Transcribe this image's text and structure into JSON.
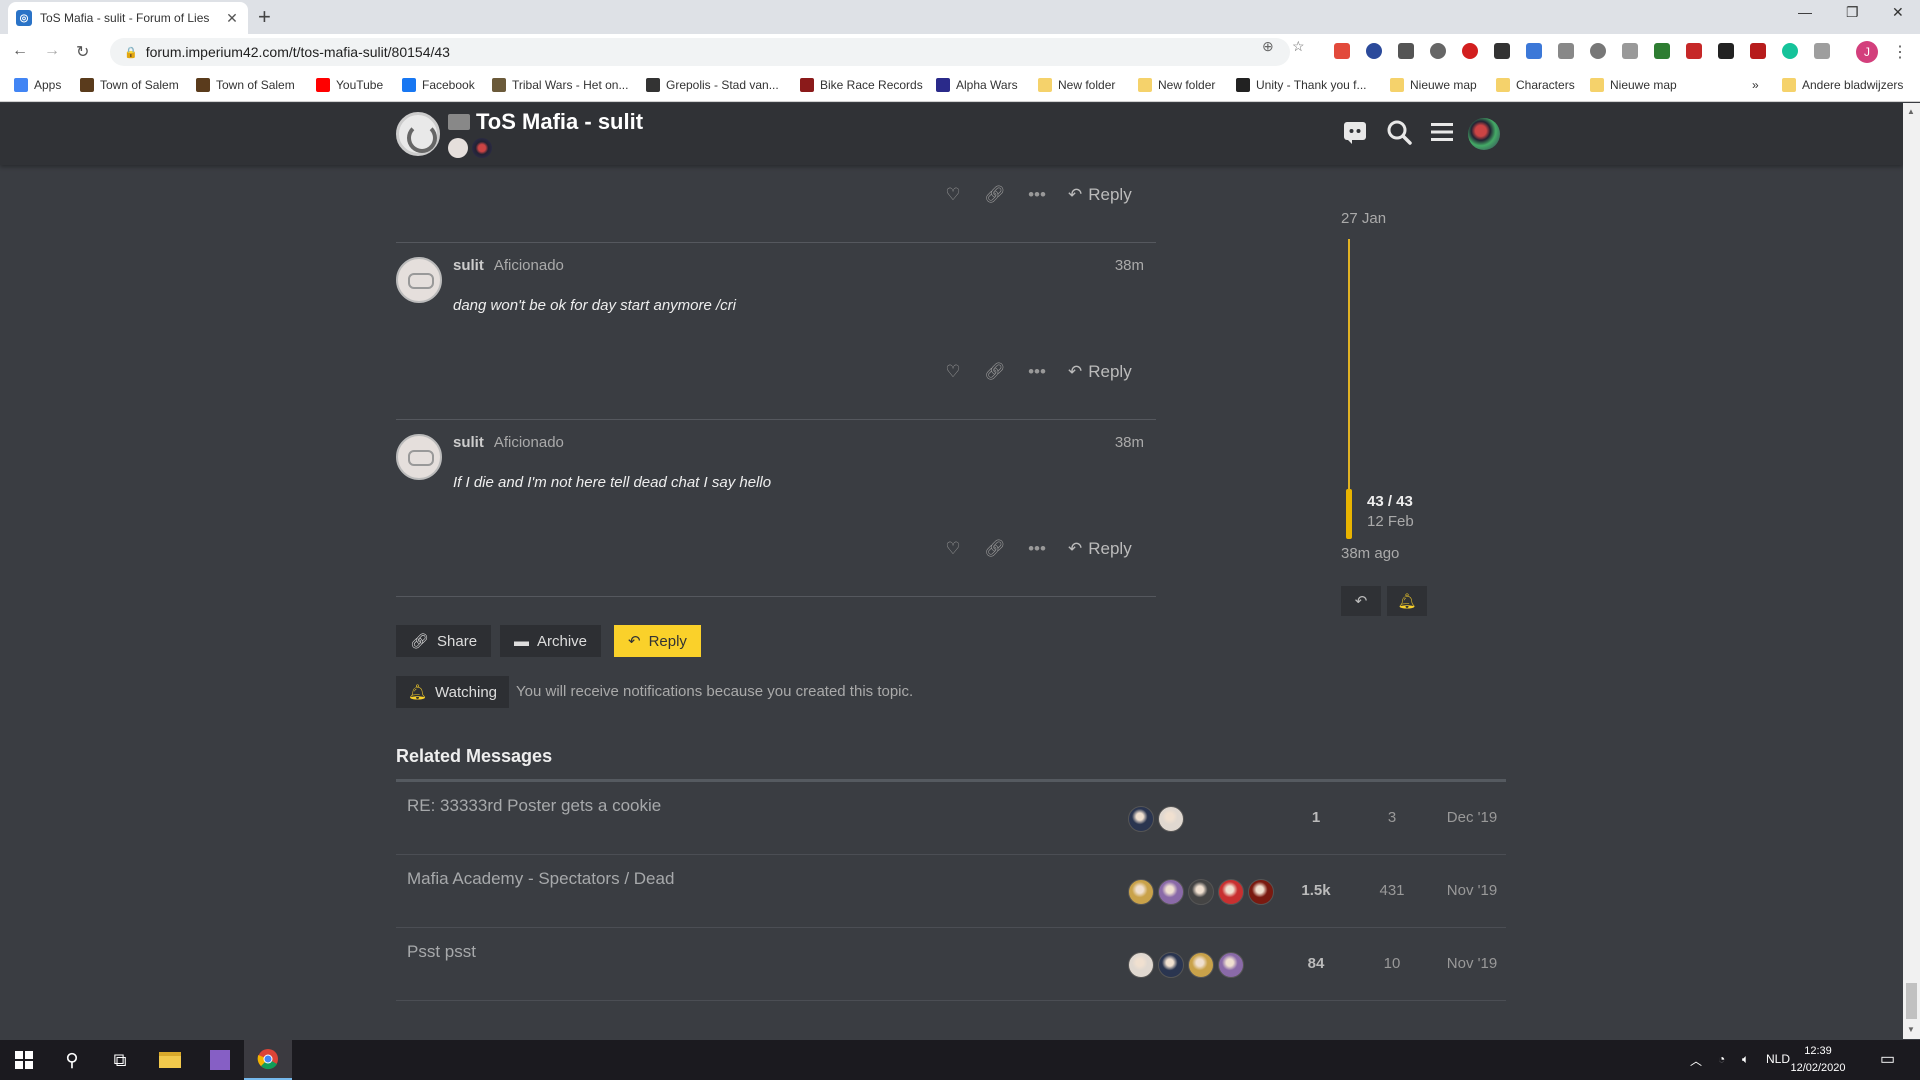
{
  "browser": {
    "tab_title": "ToS Mafia - sulit - Forum of Lies",
    "tab_icon": "forum-logo-icon",
    "url": "forum.imperium42.com/t/tos-mafia-sulit/80154/43",
    "profile_initial": "J",
    "bookmarks": [
      {
        "label": "Apps",
        "icon": "apps-grid-icon",
        "color": "#4285f4"
      },
      {
        "label": "Town of Salem",
        "icon": "tos-icon",
        "color": "#5a3b1c"
      },
      {
        "label": "Town of Salem",
        "icon": "tos-icon",
        "color": "#5a3b1c"
      },
      {
        "label": "YouTube",
        "icon": "youtube-icon",
        "color": "#ff0000"
      },
      {
        "label": "Facebook",
        "icon": "facebook-icon",
        "color": "#1877f2"
      },
      {
        "label": "Tribal Wars - Het on...",
        "icon": "tribal-wars-icon",
        "color": "#6b5a3a"
      },
      {
        "label": "Grepolis - Stad van...",
        "icon": "grepolis-icon",
        "color": "#333333"
      },
      {
        "label": "Bike Race Records",
        "icon": "bike-race-icon",
        "color": "#8b1a1a"
      },
      {
        "label": "Alpha Wars",
        "icon": "alpha-wars-icon",
        "color": "#2a2a8a"
      },
      {
        "label": "New folder",
        "icon": "folder-icon",
        "color": "#f5d26b"
      },
      {
        "label": "New folder",
        "icon": "folder-icon",
        "color": "#f5d26b"
      },
      {
        "label": "Unity - Thank you f...",
        "icon": "unity-icon",
        "color": "#222222"
      },
      {
        "label": "Nieuwe map",
        "icon": "folder-icon",
        "color": "#f5d26b"
      },
      {
        "label": "Characters",
        "icon": "folder-icon",
        "color": "#f5d26b"
      },
      {
        "label": "Nieuwe map",
        "icon": "folder-icon",
        "color": "#f5d26b"
      }
    ],
    "overflow": "»",
    "other_bookmarks": "Andere bladwijzers"
  },
  "header": {
    "title": "ToS Mafia - sulit"
  },
  "posts": [
    {
      "username": "sulit",
      "user_title": "Aficionado",
      "time": "38m",
      "body": "dang won't be ok for day start anymore /cri",
      "reply_label": "Reply"
    },
    {
      "username": "sulit",
      "user_title": "Aficionado",
      "time": "38m",
      "body": "If I die and I'm not here tell dead chat I say hello",
      "reply_label": "Reply"
    }
  ],
  "top_reply_label": "Reply",
  "timeline": {
    "start_date": "27 Jan",
    "position": "43 / 43",
    "position_date": "12 Feb",
    "last_activity": "38m ago"
  },
  "footer_buttons": {
    "share": "Share",
    "archive": "Archive",
    "reply": "Reply",
    "watching": "Watching",
    "notice": "You will receive notifications because you created this topic."
  },
  "related": {
    "title": "Related Messages",
    "rows": [
      {
        "title": "RE: 33333rd Poster gets a cookie",
        "replies": "1",
        "views": "3",
        "date": "Dec '19",
        "avatars": [
          "#2a3550",
          "#e0d8d0"
        ]
      },
      {
        "title": "Mafia Academy - Spectators / Dead",
        "replies": "1.5k",
        "views": "431",
        "date": "Nov '19",
        "avatars": [
          "#c9a24a",
          "#8a6aa8",
          "#444444",
          "#c83030",
          "#7a1a10"
        ]
      },
      {
        "title": "Psst psst",
        "replies": "84",
        "views": "10",
        "date": "Nov '19",
        "avatars": [
          "#e0d8d0",
          "#2a3550",
          "#c9a24a",
          "#8a6aa8"
        ]
      }
    ]
  },
  "taskbar": {
    "language": "NLD",
    "time": "12:39",
    "date": "12/02/2020"
  },
  "colors": {
    "accent": "#fad12a",
    "timeline": "#e1b223",
    "page_bg": "#3a3d42",
    "header_bg": "#303236"
  }
}
